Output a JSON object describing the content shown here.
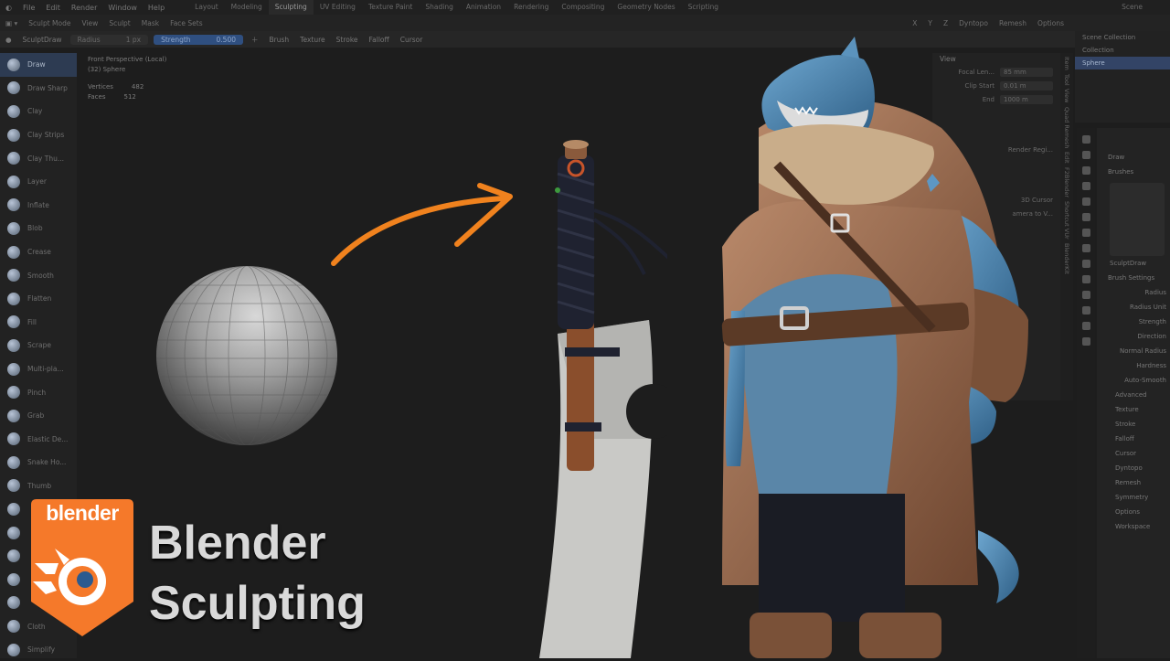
{
  "menubar": {
    "items": [
      "File",
      "Edit",
      "Render",
      "Window",
      "Help"
    ],
    "tabs": [
      "Layout",
      "Modeling",
      "Sculpting",
      "UV Editing",
      "Texture Paint",
      "Shading",
      "Animation",
      "Rendering",
      "Compositing",
      "Geometry Nodes",
      "Scripting"
    ],
    "active_tab": "Sculpting",
    "scene": "Scene"
  },
  "header": {
    "mode": "Sculpt Mode",
    "menus": [
      "View",
      "Sculpt",
      "Mask",
      "Face Sets"
    ],
    "right_items": [
      "X",
      "Y",
      "Z",
      "Dyntopo",
      "Remesh",
      "Options"
    ]
  },
  "tool_header": {
    "brush_name": "SculptDraw",
    "radius_label": "Radius",
    "radius_value": "1 px",
    "strength_label": "Strength",
    "strength_value": "0.500",
    "menus": [
      "Brush",
      "Texture",
      "Stroke",
      "Falloff",
      "Cursor"
    ]
  },
  "viewport": {
    "view_name": "Front Perspective (Local)",
    "object": "(32) Sphere",
    "stats": [
      {
        "label": "Vertices",
        "value": "482"
      },
      {
        "label": "Faces",
        "value": "512"
      }
    ]
  },
  "tools": [
    "Draw",
    "Draw Sharp",
    "Clay",
    "Clay Strips",
    "Clay Thu...",
    "Layer",
    "Inflate",
    "Blob",
    "Crease",
    "Smooth",
    "Flatten",
    "Fill",
    "Scrape",
    "Multi-pla...",
    "Pinch",
    "Grab",
    "Elastic De...",
    "Snake Ho...",
    "Thumb",
    "",
    "",
    "",
    "",
    "",
    "Cloth",
    "Simplify"
  ],
  "active_tool": "Draw",
  "n_panel": {
    "section": "View",
    "rows": [
      {
        "label": "Focal Len...",
        "value": "85 mm"
      },
      {
        "label": "Clip Start",
        "value": "0.01 m"
      },
      {
        "label": "End",
        "value": "1000 m"
      }
    ],
    "render_region": "Render Regi...",
    "cursor_label": "3D Cursor",
    "camera_label": "amera to V...",
    "tabs": [
      "Item",
      "Tool",
      "View",
      "Quad Remesh",
      "Edit",
      "F2Blender",
      "Shortcut VUr",
      "BlenderKit"
    ]
  },
  "outliner": {
    "items": [
      "Scene Collection",
      "Collection",
      "Sphere"
    ]
  },
  "properties": {
    "brush": "Draw",
    "section": "Brushes",
    "brush_name": "SculptDraw",
    "settings_title": "Brush Settings",
    "settings": [
      "Radius",
      "Radius Unit",
      "Strength",
      "Direction",
      "Normal Radius",
      "Hardness",
      "Auto-Smooth"
    ],
    "panels": [
      "Advanced",
      "Texture",
      "Stroke",
      "Falloff",
      "Cursor",
      "Dyntopo",
      "Remesh",
      "Symmetry",
      "Options",
      "Workspace"
    ]
  },
  "branding": {
    "logo_text": "blender",
    "title_line1": "Blender",
    "title_line2": "Sculpting",
    "accent": "#f5792a"
  }
}
